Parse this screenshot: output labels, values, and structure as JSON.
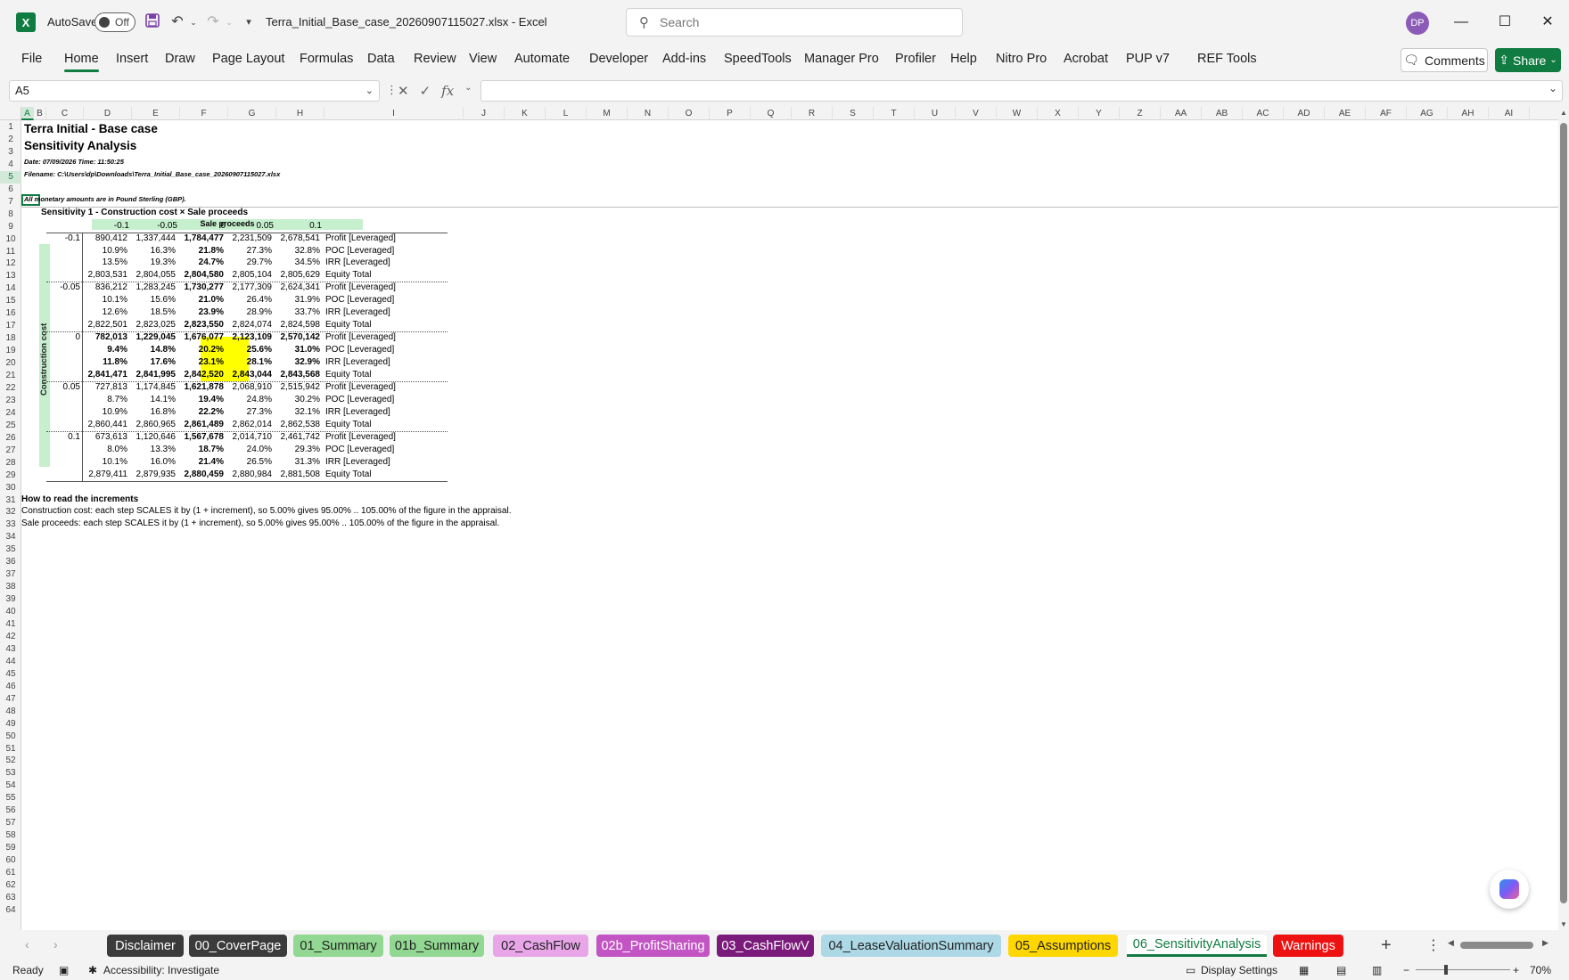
{
  "window": {
    "logo_letter": "X",
    "autosave_label": "AutoSave",
    "autosave_state": "Off",
    "file_title": "Terra_Initial_Base_case_20260907115027.xlsx  -  Excel",
    "search_placeholder": "Search",
    "user_initials": "DP"
  },
  "ribbon": {
    "tabs": [
      "File",
      "Home",
      "Insert",
      "Draw",
      "Page Layout",
      "Formulas",
      "Data",
      "Review",
      "View",
      "Automate",
      "Developer",
      "Add-ins",
      "SpeedTools",
      "Manager Pro",
      "Profiler",
      "Help",
      "Nitro Pro",
      "Acrobat",
      "PUP v7",
      "REF Tools"
    ],
    "active_tab": "Home",
    "comments_label": "Comments",
    "share_label": "Share"
  },
  "formula_bar": {
    "name_box": "A5",
    "formula": ""
  },
  "columns": [
    "A",
    "B",
    "C",
    "D",
    "E",
    "F",
    "G",
    "H",
    "I",
    "J",
    "K",
    "L",
    "M",
    "N",
    "O",
    "P",
    "Q",
    "R",
    "S",
    "T",
    "U",
    "V",
    "W",
    "X",
    "Y",
    "Z",
    "AA",
    "AB",
    "AC",
    "AD",
    "AE",
    "AF",
    "AG",
    "AH",
    "AI"
  ],
  "rows_visible": 64,
  "sheet": {
    "title": "Terra Initial - Base case",
    "subtitle": "Sensitivity Analysis",
    "date_line": "Date: 07/09/2026  Time: 11:50:25",
    "filename_line": "Filename: C:\\Users\\dp\\Downloads\\Terra_Initial_Base_case_20260907115027.xlsx",
    "currency_note": "All monetary amounts are in Pound Sterling (GBP).",
    "sensitivity_title": "Sensitivity 1 - Construction cost × Sale proceeds",
    "col_axis_label": "Sale proceeds",
    "row_axis_label": "Construction cost",
    "col_increments": [
      "-0.1",
      "-0.05",
      "0",
      "0.05",
      "0.1"
    ],
    "metrics": [
      "Profit [Leveraged]",
      "POC [Leveraged]",
      "IRR [Leveraged]",
      "Equity Total"
    ],
    "blocks": [
      {
        "increment": "-0.1",
        "rows": [
          [
            "890,412",
            "1,337,444",
            "1,784,477",
            "2,231,509",
            "2,678,541"
          ],
          [
            "10.9%",
            "16.3%",
            "21.8%",
            "27.3%",
            "32.8%"
          ],
          [
            "13.5%",
            "19.3%",
            "24.7%",
            "29.7%",
            "34.5%"
          ],
          [
            "2,803,531",
            "2,804,055",
            "2,804,580",
            "2,805,104",
            "2,805,629"
          ]
        ]
      },
      {
        "increment": "-0.05",
        "rows": [
          [
            "836,212",
            "1,283,245",
            "1,730,277",
            "2,177,309",
            "2,624,341"
          ],
          [
            "10.1%",
            "15.6%",
            "21.0%",
            "26.4%",
            "31.9%"
          ],
          [
            "12.6%",
            "18.5%",
            "23.9%",
            "28.9%",
            "33.7%"
          ],
          [
            "2,822,501",
            "2,823,025",
            "2,823,550",
            "2,824,074",
            "2,824,598"
          ]
        ]
      },
      {
        "increment": "0",
        "rows": [
          [
            "782,013",
            "1,229,045",
            "1,676,077",
            "2,123,109",
            "2,570,142"
          ],
          [
            "9.4%",
            "14.8%",
            "20.2%",
            "25.6%",
            "31.0%"
          ],
          [
            "11.8%",
            "17.6%",
            "23.1%",
            "28.1%",
            "32.9%"
          ],
          [
            "2,841,471",
            "2,841,995",
            "2,842,520",
            "2,843,044",
            "2,843,568"
          ]
        ]
      },
      {
        "increment": "0.05",
        "rows": [
          [
            "727,813",
            "1,174,845",
            "1,621,878",
            "2,068,910",
            "2,515,942"
          ],
          [
            "8.7%",
            "14.1%",
            "19.4%",
            "24.8%",
            "30.2%"
          ],
          [
            "10.9%",
            "16.8%",
            "22.2%",
            "27.3%",
            "32.1%"
          ],
          [
            "2,860,441",
            "2,860,965",
            "2,861,489",
            "2,862,014",
            "2,862,538"
          ]
        ]
      },
      {
        "increment": "0.1",
        "rows": [
          [
            "673,613",
            "1,120,646",
            "1,567,678",
            "2,014,710",
            "2,461,742"
          ],
          [
            "8.0%",
            "13.3%",
            "18.7%",
            "24.0%",
            "29.3%"
          ],
          [
            "10.1%",
            "16.0%",
            "21.4%",
            "26.5%",
            "31.3%"
          ],
          [
            "2,879,411",
            "2,879,935",
            "2,880,459",
            "2,880,984",
            "2,881,508"
          ]
        ]
      }
    ],
    "notes_title": "How to read the increments",
    "note1": "Construction cost: each step SCALES it by (1 + increment), so 5.00% gives 95.00% .. 105.00% of the figure in the appraisal.",
    "note2": "Sale proceeds: each step SCALES it by (1 + increment), so 5.00% gives 95.00% .. 105.00% of the figure in the appraisal."
  },
  "sheet_tabs": [
    {
      "label": "Disclaimer",
      "bg": "#3b3b3b",
      "fg": "#ffffff"
    },
    {
      "label": "00_CoverPage",
      "bg": "#3b3b3b",
      "fg": "#ffffff"
    },
    {
      "label": "01_Summary",
      "bg": "#92d892",
      "fg": "#1f1f1f"
    },
    {
      "label": "01b_Summary",
      "bg": "#92d892",
      "fg": "#1f1f1f"
    },
    {
      "label": "02_CashFlow",
      "bg": "#e8a6e8",
      "fg": "#1f1f1f"
    },
    {
      "label": "02b_ProfitSharing",
      "bg": "#c354c3",
      "fg": "#ffffff"
    },
    {
      "label": "03_CashFlowV",
      "bg": "#7a1a7a",
      "fg": "#ffffff"
    },
    {
      "label": "04_LeaseValuationSummary",
      "bg": "#add8e6",
      "fg": "#1f1f1f"
    },
    {
      "label": "05_Assumptions",
      "bg": "#ffd700",
      "fg": "#1f1f1f"
    },
    {
      "label": "06_SensitivityAnalysis",
      "bg": "#ffffff",
      "fg": "#107c41",
      "active": true
    },
    {
      "label": "Warnings",
      "bg": "#ee1111",
      "fg": "#ffffff"
    }
  ],
  "status": {
    "ready": "Ready",
    "accessibility": "Accessibility: Investigate",
    "display_settings": "Display Settings",
    "zoom": "70%"
  },
  "colors": {
    "excel_green": "#107c41",
    "highlight_yellow": "#ffff00",
    "header_green": "#c6efce"
  }
}
